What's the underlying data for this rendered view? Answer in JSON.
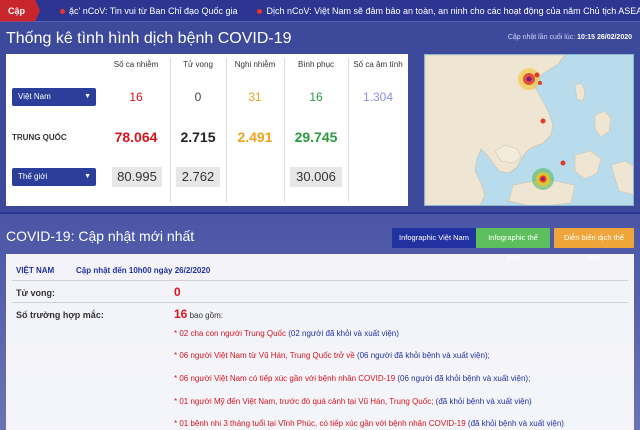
{
  "ticker": {
    "label": "Cập nhật:",
    "items": [
      "ặc' nCoV: Tin vui từ Ban Chỉ đạo Quốc gia",
      "Dịch nCoV: Việt Nam sẽ đảm bảo an toàn, an ninh cho các hoạt động của năm Chủ tịch ASEAN"
    ]
  },
  "stats": {
    "title": "Thống kê tình hình dịch bệnh COVID-19",
    "updated_label": "Cập nhật lần cuối lúc:",
    "updated_value": "10:15 26/02/2020",
    "columns": [
      "Số ca nhiễm",
      "Tử vong",
      "Nghi nhiễm",
      "Bình phục",
      "Số ca âm tính"
    ],
    "rows": {
      "vietnam": {
        "label": "Việt Nam",
        "cases": "16",
        "deaths": "0",
        "suspected": "31",
        "recovered": "16",
        "negative": "1.304"
      },
      "china": {
        "label": "TRUNG QUỐC",
        "cases": "78.064",
        "deaths": "2.715",
        "suspected": "2.491",
        "recovered": "29.745"
      },
      "world": {
        "label": "Thế giới",
        "cases": "80.995",
        "deaths": "2.762",
        "recovered": "30.006"
      }
    }
  },
  "news": {
    "title": "COVID-19: Cập nhật mới nhất",
    "buttons": [
      "Infographic Việt Nam",
      "Infographic thế giới",
      "Diễn biến dịch thế giới"
    ],
    "country": "VIỆT NAM",
    "update_line": "Cập nhật đến 10h00 ngày 26/2/2020",
    "deaths_label": "Tử vong:",
    "deaths_value": "0",
    "cases_label": "Số trường hợp mắc:",
    "cases_value": "16",
    "cases_suffix": "bao gồm:",
    "items": [
      {
        "red": "* 02 cha con người Trung Quốc",
        "blue": "(02 người đã khỏi và xuất viện)"
      },
      {
        "red": "* 06 người Việt Nam từ Vũ Hán, Trung Quốc trở về",
        "blue": "(06 người đã khỏi bệnh và xuất viện);"
      },
      {
        "red": "* 06 người Việt Nam có tiếp xúc gần với bệnh nhân COVID-19",
        "blue": "(06 người đã khỏi bệnh và xuất viện);"
      },
      {
        "red": "* 01 người Mỹ đến Việt Nam, trước đó  quá cảnh tại Vũ Hán, Trung Quốc;",
        "blue": "(đã khỏi bệnh và xuất viện)"
      },
      {
        "red": "* 01 bệnh nhi 3 tháng tuổi tại Vĩnh Phúc, có tiếp xúc gần với bệnh nhân COVID-19",
        "blue": "(đã khỏi bệnh và xuất viện)"
      }
    ]
  },
  "colors": {
    "background": "#3d4a9b",
    "ticker_bg": "#2c3592",
    "ticker_label": "#c9252c",
    "cases": "#d9141e",
    "suspected": "#f0a31c",
    "recovered": "#2b9a3e",
    "negative": "#8c8fe0",
    "btn_vn": "#2231a0",
    "btn_world": "#5cbf5c",
    "btn_trend": "#f0a53a"
  }
}
